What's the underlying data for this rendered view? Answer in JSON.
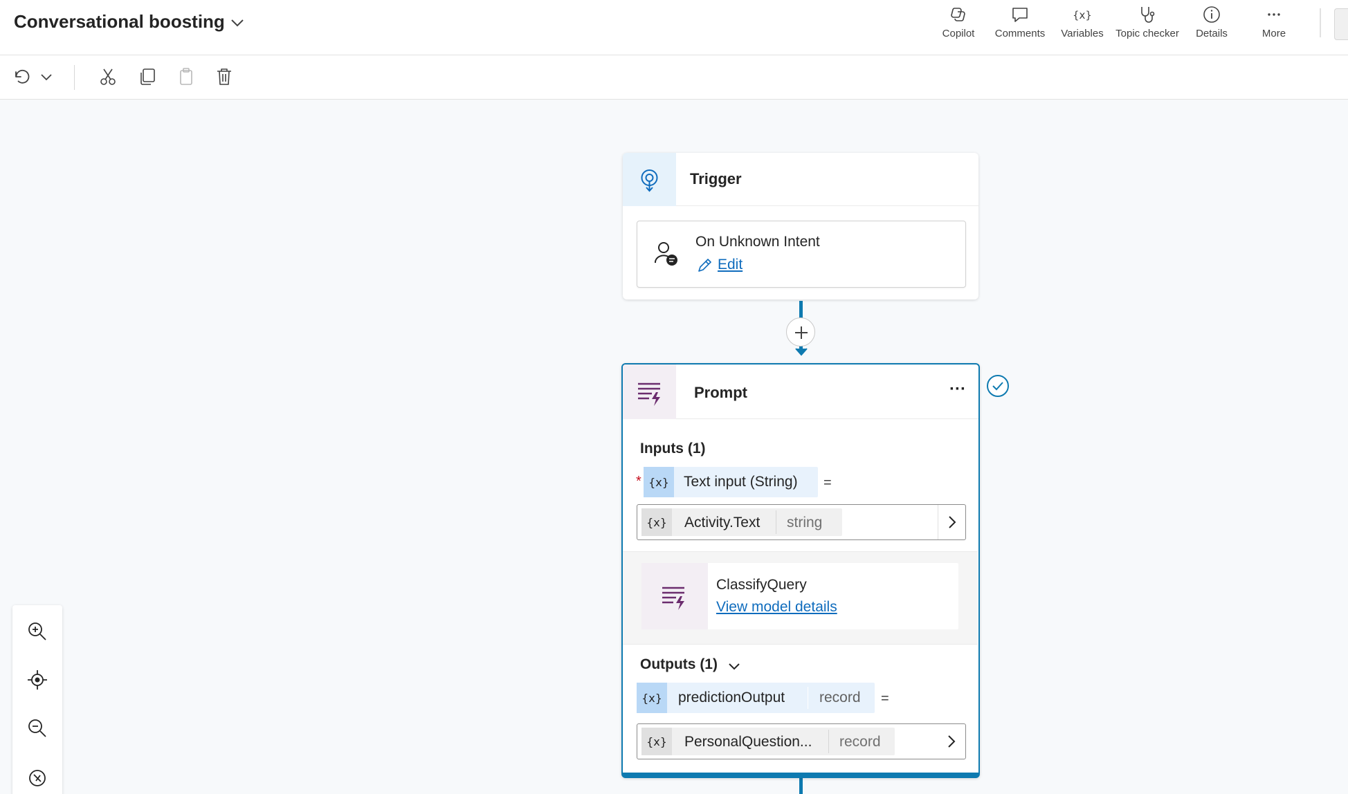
{
  "header": {
    "title": "Conversational boosting",
    "commands": [
      {
        "label": "Copilot",
        "icon": "copilot-icon"
      },
      {
        "label": "Comments",
        "icon": "comment-icon"
      },
      {
        "label": "Variables",
        "icon": "variables-icon"
      },
      {
        "label": "Topic checker",
        "icon": "stethoscope-icon"
      },
      {
        "label": "Details",
        "icon": "info-icon"
      },
      {
        "label": "More",
        "icon": "more-icon"
      }
    ]
  },
  "toolbar": {
    "icons": [
      "undo-icon",
      "chevron-down-icon",
      "cut-icon",
      "copy-icon",
      "paste-icon",
      "delete-icon"
    ]
  },
  "trigger": {
    "title": "Trigger",
    "event": "On Unknown Intent",
    "edit_label": "Edit"
  },
  "prompt": {
    "title": "Prompt",
    "more": "···",
    "inputs_label": "Inputs (1)",
    "required_mark": "*",
    "input_var": "Text input (String)",
    "equals": "=",
    "input_value": "Activity.Text",
    "input_value_type": "string",
    "model_name": "ClassifyQuery",
    "model_link": "View model details",
    "outputs_label": "Outputs (1)",
    "output_var": "predictionOutput",
    "output_var_type": "record",
    "output_value": "PersonalQuestion...",
    "output_value_type": "record"
  },
  "colors": {
    "accent": "#0e7ab0",
    "link": "#0f6cbd",
    "prompt_icon": "#6b2c6e",
    "trigger_icon": "#0f6cbd",
    "required": "#c50f1f"
  }
}
